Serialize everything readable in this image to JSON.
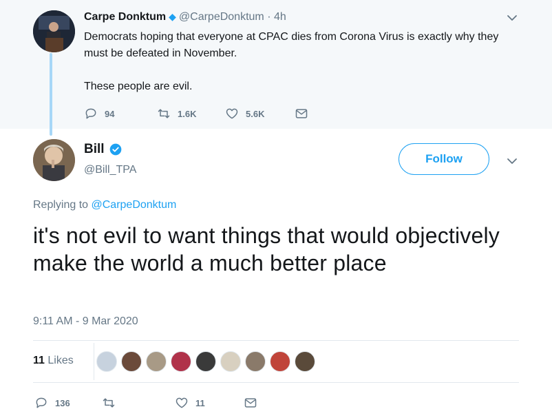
{
  "parent_tweet": {
    "author_name": "Carpe Donktum",
    "handle": "@CarpeDonktum",
    "time": "· 4h",
    "text_lines": [
      "Democrats hoping that everyone at CPAC dies from Corona Virus is exactly why they must be defeated in November.",
      "These people are evil."
    ],
    "replies": "94",
    "retweets": "1.6K",
    "likes": "5.6K"
  },
  "main_tweet": {
    "author_name": "Bill",
    "handle": "@Bill_TPA",
    "follow_label": "Follow",
    "replying_prefix": "Replying to",
    "replying_handle": "@CarpeDonktum",
    "text": "it's not evil to want things that would objectively make the world a much better place",
    "timestamp": "9:11 AM - 9 Mar 2020",
    "likes_count": "11",
    "likes_label": "Likes",
    "replies": "136",
    "retweets": "",
    "likes": "11"
  },
  "colors": {
    "accent": "#1da1f2",
    "muted": "#657786",
    "parent_bg": "#f5f8fa",
    "thread_line": "#a7d7f7"
  },
  "icons": [
    "reply-icon",
    "retweet-icon",
    "like-icon",
    "message-icon",
    "chevron-down-icon",
    "verified-badge-icon"
  ],
  "liker_avatars": [
    {
      "bg": "#c7d2de"
    },
    {
      "bg": "#6b4a3a"
    },
    {
      "bg": "#a89a86"
    },
    {
      "bg": "#b0324a"
    },
    {
      "bg": "#3a3a3a"
    },
    {
      "bg": "#d8d0c0"
    },
    {
      "bg": "#8a7a6a"
    },
    {
      "bg": "#c0443a"
    },
    {
      "bg": "#5a4a3a"
    }
  ]
}
